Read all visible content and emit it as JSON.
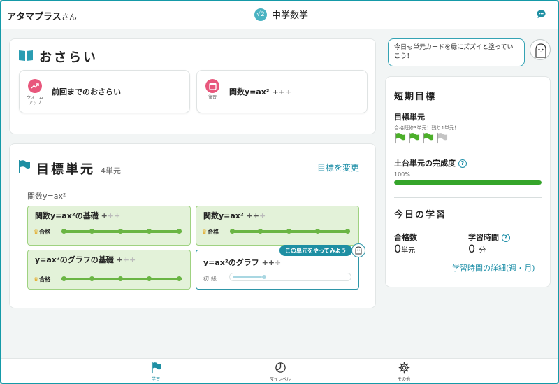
{
  "header": {
    "brand": "アタマプラス",
    "brand_suffix": "さん",
    "subject_icon": "√2",
    "subject": "中学数学"
  },
  "review": {
    "title": "おさらい",
    "items": [
      {
        "icon": "trend-up-icon",
        "caption": "ウォーム\nアップ",
        "label": "前回までのおさらい"
      },
      {
        "icon": "notebook-icon",
        "caption": "復習",
        "label_main": "関数y=ax² ++",
        "label_dim": "+"
      }
    ]
  },
  "goal": {
    "title": "目標単元",
    "count": "4単元",
    "change_label": "目標を変更",
    "group_label": "関数y=ax²",
    "units": [
      {
        "name": "関数y=ax²の基礎",
        "plus_on": "+",
        "plus_dim": "++",
        "badge": "合格",
        "status": "passed"
      },
      {
        "name": "関数y=ax²",
        "plus_on": "++",
        "plus_dim": "+",
        "badge": "合格",
        "status": "passed"
      },
      {
        "name": "y=ax²のグラフの基礎",
        "plus_on": "+",
        "plus_dim": "++",
        "badge": "合格",
        "status": "passed"
      },
      {
        "name": "y=ax²のグラフ",
        "plus_on": "++",
        "plus_dim": "+",
        "level": "初級",
        "tooltip": "この単元をやってみよう",
        "status": "current",
        "progress": 0.25
      }
    ]
  },
  "mascot": {
    "message": "今日も単元カードを緑にズズイと塗っていこう！"
  },
  "short_term": {
    "title": "短期目標",
    "target_label": "目標単元",
    "target_note": "合格既修3単元！残り1単元！",
    "flags": {
      "done": 3,
      "total": 4,
      "done_color": "#4caf2a",
      "todo_color": "#c4c4c4"
    },
    "foundation_label": "土台単元の完成度",
    "foundation_value": "100%",
    "foundation_fraction": 1.0
  },
  "today": {
    "title": "今日の学習",
    "passed_label": "合格数",
    "passed_value": "0",
    "passed_unit": "単元",
    "time_label": "学習時間",
    "time_value": "0",
    "time_unit": "分",
    "detail_link": "学習時間の詳細(週・月)"
  },
  "bottom_nav": [
    {
      "label": "学習",
      "icon": "flag-icon",
      "active": true
    },
    {
      "label": "マイレベル",
      "icon": "pie-chart-icon",
      "active": false
    },
    {
      "label": "その他",
      "icon": "gear-icon",
      "active": false
    }
  ],
  "colors": {
    "accent": "#1e8fa3",
    "passed_bg": "#e3f2d9",
    "progress_green": "#35a52a"
  }
}
